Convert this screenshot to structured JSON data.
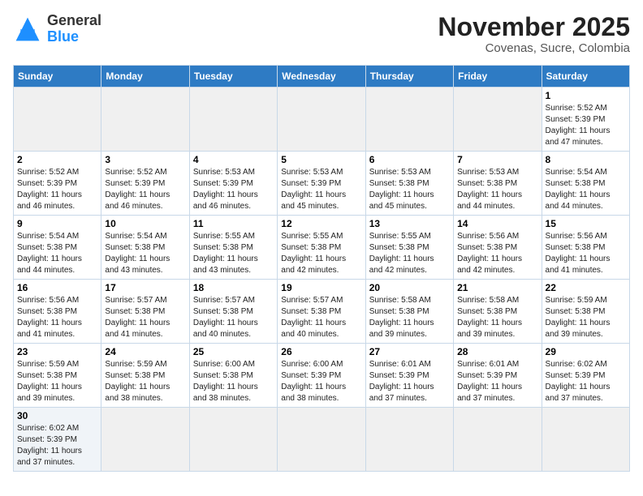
{
  "header": {
    "logo_general": "General",
    "logo_blue": "Blue",
    "month_title": "November 2025",
    "location": "Covenas, Sucre, Colombia"
  },
  "days_of_week": [
    "Sunday",
    "Monday",
    "Tuesday",
    "Wednesday",
    "Thursday",
    "Friday",
    "Saturday"
  ],
  "weeks": [
    [
      {
        "num": "",
        "info": "",
        "empty": true
      },
      {
        "num": "",
        "info": "",
        "empty": true
      },
      {
        "num": "",
        "info": "",
        "empty": true
      },
      {
        "num": "",
        "info": "",
        "empty": true
      },
      {
        "num": "",
        "info": "",
        "empty": true
      },
      {
        "num": "",
        "info": "",
        "empty": true
      },
      {
        "num": "1",
        "info": "Sunrise: 5:52 AM\nSunset: 5:39 PM\nDaylight: 11 hours\nand 47 minutes."
      }
    ],
    [
      {
        "num": "2",
        "info": "Sunrise: 5:52 AM\nSunset: 5:39 PM\nDaylight: 11 hours\nand 46 minutes."
      },
      {
        "num": "3",
        "info": "Sunrise: 5:52 AM\nSunset: 5:39 PM\nDaylight: 11 hours\nand 46 minutes."
      },
      {
        "num": "4",
        "info": "Sunrise: 5:53 AM\nSunset: 5:39 PM\nDaylight: 11 hours\nand 46 minutes."
      },
      {
        "num": "5",
        "info": "Sunrise: 5:53 AM\nSunset: 5:39 PM\nDaylight: 11 hours\nand 45 minutes."
      },
      {
        "num": "6",
        "info": "Sunrise: 5:53 AM\nSunset: 5:38 PM\nDaylight: 11 hours\nand 45 minutes."
      },
      {
        "num": "7",
        "info": "Sunrise: 5:53 AM\nSunset: 5:38 PM\nDaylight: 11 hours\nand 44 minutes."
      },
      {
        "num": "8",
        "info": "Sunrise: 5:54 AM\nSunset: 5:38 PM\nDaylight: 11 hours\nand 44 minutes."
      }
    ],
    [
      {
        "num": "9",
        "info": "Sunrise: 5:54 AM\nSunset: 5:38 PM\nDaylight: 11 hours\nand 44 minutes."
      },
      {
        "num": "10",
        "info": "Sunrise: 5:54 AM\nSunset: 5:38 PM\nDaylight: 11 hours\nand 43 minutes."
      },
      {
        "num": "11",
        "info": "Sunrise: 5:55 AM\nSunset: 5:38 PM\nDaylight: 11 hours\nand 43 minutes."
      },
      {
        "num": "12",
        "info": "Sunrise: 5:55 AM\nSunset: 5:38 PM\nDaylight: 11 hours\nand 42 minutes."
      },
      {
        "num": "13",
        "info": "Sunrise: 5:55 AM\nSunset: 5:38 PM\nDaylight: 11 hours\nand 42 minutes."
      },
      {
        "num": "14",
        "info": "Sunrise: 5:56 AM\nSunset: 5:38 PM\nDaylight: 11 hours\nand 42 minutes."
      },
      {
        "num": "15",
        "info": "Sunrise: 5:56 AM\nSunset: 5:38 PM\nDaylight: 11 hours\nand 41 minutes."
      }
    ],
    [
      {
        "num": "16",
        "info": "Sunrise: 5:56 AM\nSunset: 5:38 PM\nDaylight: 11 hours\nand 41 minutes."
      },
      {
        "num": "17",
        "info": "Sunrise: 5:57 AM\nSunset: 5:38 PM\nDaylight: 11 hours\nand 41 minutes."
      },
      {
        "num": "18",
        "info": "Sunrise: 5:57 AM\nSunset: 5:38 PM\nDaylight: 11 hours\nand 40 minutes."
      },
      {
        "num": "19",
        "info": "Sunrise: 5:57 AM\nSunset: 5:38 PM\nDaylight: 11 hours\nand 40 minutes."
      },
      {
        "num": "20",
        "info": "Sunrise: 5:58 AM\nSunset: 5:38 PM\nDaylight: 11 hours\nand 39 minutes."
      },
      {
        "num": "21",
        "info": "Sunrise: 5:58 AM\nSunset: 5:38 PM\nDaylight: 11 hours\nand 39 minutes."
      },
      {
        "num": "22",
        "info": "Sunrise: 5:59 AM\nSunset: 5:38 PM\nDaylight: 11 hours\nand 39 minutes."
      }
    ],
    [
      {
        "num": "23",
        "info": "Sunrise: 5:59 AM\nSunset: 5:38 PM\nDaylight: 11 hours\nand 39 minutes."
      },
      {
        "num": "24",
        "info": "Sunrise: 5:59 AM\nSunset: 5:38 PM\nDaylight: 11 hours\nand 38 minutes."
      },
      {
        "num": "25",
        "info": "Sunrise: 6:00 AM\nSunset: 5:38 PM\nDaylight: 11 hours\nand 38 minutes."
      },
      {
        "num": "26",
        "info": "Sunrise: 6:00 AM\nSunset: 5:39 PM\nDaylight: 11 hours\nand 38 minutes."
      },
      {
        "num": "27",
        "info": "Sunrise: 6:01 AM\nSunset: 5:39 PM\nDaylight: 11 hours\nand 37 minutes."
      },
      {
        "num": "28",
        "info": "Sunrise: 6:01 AM\nSunset: 5:39 PM\nDaylight: 11 hours\nand 37 minutes."
      },
      {
        "num": "29",
        "info": "Sunrise: 6:02 AM\nSunset: 5:39 PM\nDaylight: 11 hours\nand 37 minutes."
      }
    ],
    [
      {
        "num": "30",
        "info": "Sunrise: 6:02 AM\nSunset: 5:39 PM\nDaylight: 11 hours\nand 37 minutes."
      },
      {
        "num": "",
        "info": "",
        "empty": true
      },
      {
        "num": "",
        "info": "",
        "empty": true
      },
      {
        "num": "",
        "info": "",
        "empty": true
      },
      {
        "num": "",
        "info": "",
        "empty": true
      },
      {
        "num": "",
        "info": "",
        "empty": true
      },
      {
        "num": "",
        "info": "",
        "empty": true
      }
    ]
  ]
}
